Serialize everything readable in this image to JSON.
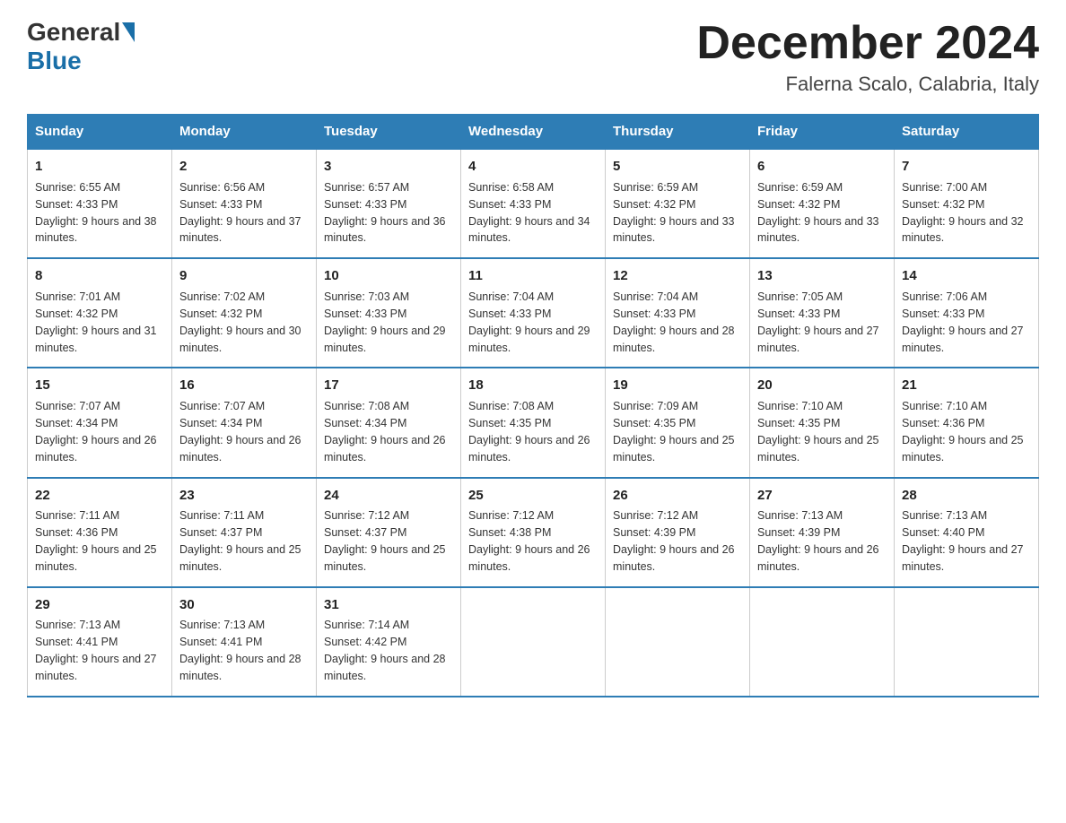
{
  "header": {
    "logo_general": "General",
    "logo_blue": "Blue",
    "month_title": "December 2024",
    "location": "Falerna Scalo, Calabria, Italy"
  },
  "days_of_week": [
    "Sunday",
    "Monday",
    "Tuesday",
    "Wednesday",
    "Thursday",
    "Friday",
    "Saturday"
  ],
  "weeks": [
    [
      {
        "day": "1",
        "sunrise": "6:55 AM",
        "sunset": "4:33 PM",
        "daylight": "9 hours and 38 minutes."
      },
      {
        "day": "2",
        "sunrise": "6:56 AM",
        "sunset": "4:33 PM",
        "daylight": "9 hours and 37 minutes."
      },
      {
        "day": "3",
        "sunrise": "6:57 AM",
        "sunset": "4:33 PM",
        "daylight": "9 hours and 36 minutes."
      },
      {
        "day": "4",
        "sunrise": "6:58 AM",
        "sunset": "4:33 PM",
        "daylight": "9 hours and 34 minutes."
      },
      {
        "day": "5",
        "sunrise": "6:59 AM",
        "sunset": "4:32 PM",
        "daylight": "9 hours and 33 minutes."
      },
      {
        "day": "6",
        "sunrise": "6:59 AM",
        "sunset": "4:32 PM",
        "daylight": "9 hours and 33 minutes."
      },
      {
        "day": "7",
        "sunrise": "7:00 AM",
        "sunset": "4:32 PM",
        "daylight": "9 hours and 32 minutes."
      }
    ],
    [
      {
        "day": "8",
        "sunrise": "7:01 AM",
        "sunset": "4:32 PM",
        "daylight": "9 hours and 31 minutes."
      },
      {
        "day": "9",
        "sunrise": "7:02 AM",
        "sunset": "4:32 PM",
        "daylight": "9 hours and 30 minutes."
      },
      {
        "day": "10",
        "sunrise": "7:03 AM",
        "sunset": "4:33 PM",
        "daylight": "9 hours and 29 minutes."
      },
      {
        "day": "11",
        "sunrise": "7:04 AM",
        "sunset": "4:33 PM",
        "daylight": "9 hours and 29 minutes."
      },
      {
        "day": "12",
        "sunrise": "7:04 AM",
        "sunset": "4:33 PM",
        "daylight": "9 hours and 28 minutes."
      },
      {
        "day": "13",
        "sunrise": "7:05 AM",
        "sunset": "4:33 PM",
        "daylight": "9 hours and 27 minutes."
      },
      {
        "day": "14",
        "sunrise": "7:06 AM",
        "sunset": "4:33 PM",
        "daylight": "9 hours and 27 minutes."
      }
    ],
    [
      {
        "day": "15",
        "sunrise": "7:07 AM",
        "sunset": "4:34 PM",
        "daylight": "9 hours and 26 minutes."
      },
      {
        "day": "16",
        "sunrise": "7:07 AM",
        "sunset": "4:34 PM",
        "daylight": "9 hours and 26 minutes."
      },
      {
        "day": "17",
        "sunrise": "7:08 AM",
        "sunset": "4:34 PM",
        "daylight": "9 hours and 26 minutes."
      },
      {
        "day": "18",
        "sunrise": "7:08 AM",
        "sunset": "4:35 PM",
        "daylight": "9 hours and 26 minutes."
      },
      {
        "day": "19",
        "sunrise": "7:09 AM",
        "sunset": "4:35 PM",
        "daylight": "9 hours and 25 minutes."
      },
      {
        "day": "20",
        "sunrise": "7:10 AM",
        "sunset": "4:35 PM",
        "daylight": "9 hours and 25 minutes."
      },
      {
        "day": "21",
        "sunrise": "7:10 AM",
        "sunset": "4:36 PM",
        "daylight": "9 hours and 25 minutes."
      }
    ],
    [
      {
        "day": "22",
        "sunrise": "7:11 AM",
        "sunset": "4:36 PM",
        "daylight": "9 hours and 25 minutes."
      },
      {
        "day": "23",
        "sunrise": "7:11 AM",
        "sunset": "4:37 PM",
        "daylight": "9 hours and 25 minutes."
      },
      {
        "day": "24",
        "sunrise": "7:12 AM",
        "sunset": "4:37 PM",
        "daylight": "9 hours and 25 minutes."
      },
      {
        "day": "25",
        "sunrise": "7:12 AM",
        "sunset": "4:38 PM",
        "daylight": "9 hours and 26 minutes."
      },
      {
        "day": "26",
        "sunrise": "7:12 AM",
        "sunset": "4:39 PM",
        "daylight": "9 hours and 26 minutes."
      },
      {
        "day": "27",
        "sunrise": "7:13 AM",
        "sunset": "4:39 PM",
        "daylight": "9 hours and 26 minutes."
      },
      {
        "day": "28",
        "sunrise": "7:13 AM",
        "sunset": "4:40 PM",
        "daylight": "9 hours and 27 minutes."
      }
    ],
    [
      {
        "day": "29",
        "sunrise": "7:13 AM",
        "sunset": "4:41 PM",
        "daylight": "9 hours and 27 minutes."
      },
      {
        "day": "30",
        "sunrise": "7:13 AM",
        "sunset": "4:41 PM",
        "daylight": "9 hours and 28 minutes."
      },
      {
        "day": "31",
        "sunrise": "7:14 AM",
        "sunset": "4:42 PM",
        "daylight": "9 hours and 28 minutes."
      },
      null,
      null,
      null,
      null
    ]
  ]
}
